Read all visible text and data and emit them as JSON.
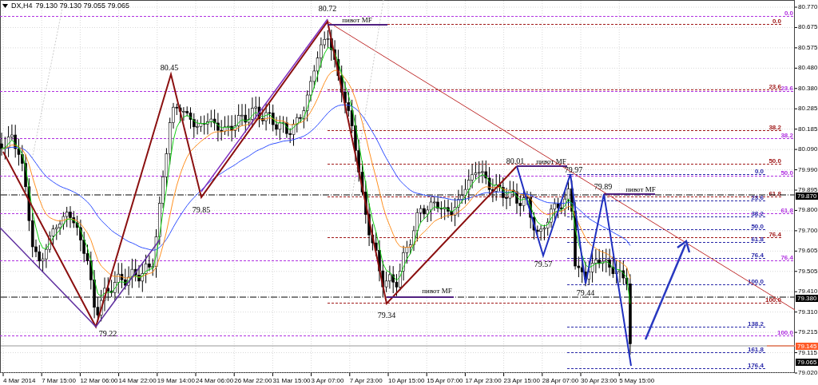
{
  "header": {
    "symbol": "DX,H4",
    "quote": "79.130 79.130 79.055 79.065"
  },
  "price_axis": {
    "ticks": [
      "80.770",
      "80.675",
      "80.575",
      "80.480",
      "80.380",
      "80.285",
      "80.185",
      "80.090",
      "79.990",
      "79.895",
      "79.800",
      "79.700",
      "79.605",
      "79.505",
      "79.410",
      "79.310",
      "79.215",
      "79.115",
      "79.020"
    ]
  },
  "price_tags": [
    {
      "text": "79.870",
      "kind": "line"
    },
    {
      "text": "79.380",
      "kind": "line"
    },
    {
      "text": "79.145",
      "kind": "bid"
    },
    {
      "text": "79.065",
      "kind": "line"
    }
  ],
  "time_axis": {
    "labels": [
      "4 Mar 2014",
      "7 Mar 15:00",
      "12 Mar 06:00",
      "14 Mar 22:00",
      "19 Mar 14:00",
      "24 Mar 06:00",
      "26 Mar 22:00",
      "31 Mar 15:00",
      "3 Apr 07:00",
      "7 Apr 23:00",
      "10 Apr 15:00",
      "15 Apr 07:00",
      "17 Apr 23:00",
      "23 Apr 15:00",
      "28 Apr 07:00",
      "30 Apr 23:00",
      "5 May 15:00"
    ]
  },
  "swing_labels": [
    "80.72",
    "80.45",
    "79.85",
    "79.22",
    "79.34",
    "80.01",
    "79.97",
    "79.57",
    "79.89",
    "79.44"
  ],
  "pivot_labels": [
    "пивот MF",
    "пивот MF",
    "пивот MF",
    "пивот MF"
  ],
  "fib_sets": [
    {
      "color": "#a01818",
      "levels": [
        "0.0",
        "23.6",
        "38.2",
        "50.0",
        "61.8",
        "76.4",
        "100.0"
      ]
    },
    {
      "color": "#b030e0",
      "levels": [
        "0.0",
        "23.6",
        "38.2",
        "50.0",
        "61.8",
        "76.4",
        "100.0"
      ]
    },
    {
      "color": "#2828a8",
      "levels": [
        "0.0",
        "23.6",
        "38.2",
        "50.0",
        "61.8",
        "76.4",
        "100.0",
        "138.2",
        "161.8",
        "176.4"
      ]
    }
  ]
}
